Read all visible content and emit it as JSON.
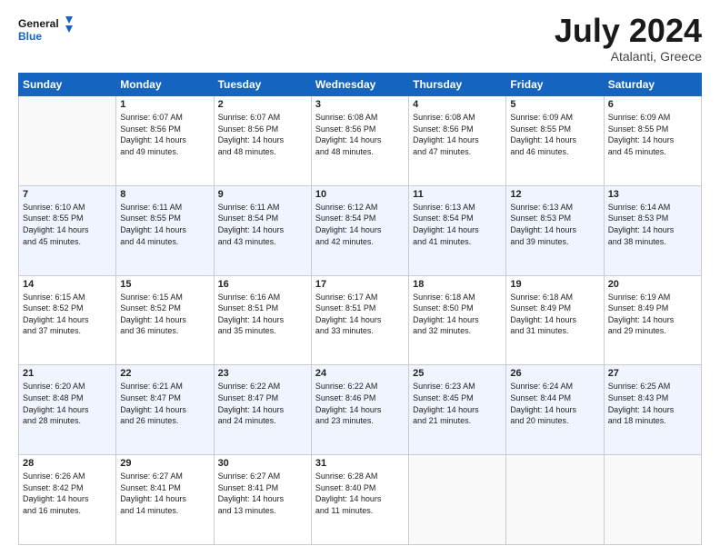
{
  "logo": {
    "line1": "General",
    "line2": "Blue"
  },
  "title": "July 2024",
  "subtitle": "Atalanti, Greece",
  "days_header": [
    "Sunday",
    "Monday",
    "Tuesday",
    "Wednesday",
    "Thursday",
    "Friday",
    "Saturday"
  ],
  "weeks": [
    [
      {
        "day": "",
        "info": ""
      },
      {
        "day": "1",
        "info": "Sunrise: 6:07 AM\nSunset: 8:56 PM\nDaylight: 14 hours\nand 49 minutes."
      },
      {
        "day": "2",
        "info": "Sunrise: 6:07 AM\nSunset: 8:56 PM\nDaylight: 14 hours\nand 48 minutes."
      },
      {
        "day": "3",
        "info": "Sunrise: 6:08 AM\nSunset: 8:56 PM\nDaylight: 14 hours\nand 48 minutes."
      },
      {
        "day": "4",
        "info": "Sunrise: 6:08 AM\nSunset: 8:56 PM\nDaylight: 14 hours\nand 47 minutes."
      },
      {
        "day": "5",
        "info": "Sunrise: 6:09 AM\nSunset: 8:55 PM\nDaylight: 14 hours\nand 46 minutes."
      },
      {
        "day": "6",
        "info": "Sunrise: 6:09 AM\nSunset: 8:55 PM\nDaylight: 14 hours\nand 45 minutes."
      }
    ],
    [
      {
        "day": "7",
        "info": "Sunrise: 6:10 AM\nSunset: 8:55 PM\nDaylight: 14 hours\nand 45 minutes."
      },
      {
        "day": "8",
        "info": "Sunrise: 6:11 AM\nSunset: 8:55 PM\nDaylight: 14 hours\nand 44 minutes."
      },
      {
        "day": "9",
        "info": "Sunrise: 6:11 AM\nSunset: 8:54 PM\nDaylight: 14 hours\nand 43 minutes."
      },
      {
        "day": "10",
        "info": "Sunrise: 6:12 AM\nSunset: 8:54 PM\nDaylight: 14 hours\nand 42 minutes."
      },
      {
        "day": "11",
        "info": "Sunrise: 6:13 AM\nSunset: 8:54 PM\nDaylight: 14 hours\nand 41 minutes."
      },
      {
        "day": "12",
        "info": "Sunrise: 6:13 AM\nSunset: 8:53 PM\nDaylight: 14 hours\nand 39 minutes."
      },
      {
        "day": "13",
        "info": "Sunrise: 6:14 AM\nSunset: 8:53 PM\nDaylight: 14 hours\nand 38 minutes."
      }
    ],
    [
      {
        "day": "14",
        "info": "Sunrise: 6:15 AM\nSunset: 8:52 PM\nDaylight: 14 hours\nand 37 minutes."
      },
      {
        "day": "15",
        "info": "Sunrise: 6:15 AM\nSunset: 8:52 PM\nDaylight: 14 hours\nand 36 minutes."
      },
      {
        "day": "16",
        "info": "Sunrise: 6:16 AM\nSunset: 8:51 PM\nDaylight: 14 hours\nand 35 minutes."
      },
      {
        "day": "17",
        "info": "Sunrise: 6:17 AM\nSunset: 8:51 PM\nDaylight: 14 hours\nand 33 minutes."
      },
      {
        "day": "18",
        "info": "Sunrise: 6:18 AM\nSunset: 8:50 PM\nDaylight: 14 hours\nand 32 minutes."
      },
      {
        "day": "19",
        "info": "Sunrise: 6:18 AM\nSunset: 8:49 PM\nDaylight: 14 hours\nand 31 minutes."
      },
      {
        "day": "20",
        "info": "Sunrise: 6:19 AM\nSunset: 8:49 PM\nDaylight: 14 hours\nand 29 minutes."
      }
    ],
    [
      {
        "day": "21",
        "info": "Sunrise: 6:20 AM\nSunset: 8:48 PM\nDaylight: 14 hours\nand 28 minutes."
      },
      {
        "day": "22",
        "info": "Sunrise: 6:21 AM\nSunset: 8:47 PM\nDaylight: 14 hours\nand 26 minutes."
      },
      {
        "day": "23",
        "info": "Sunrise: 6:22 AM\nSunset: 8:47 PM\nDaylight: 14 hours\nand 24 minutes."
      },
      {
        "day": "24",
        "info": "Sunrise: 6:22 AM\nSunset: 8:46 PM\nDaylight: 14 hours\nand 23 minutes."
      },
      {
        "day": "25",
        "info": "Sunrise: 6:23 AM\nSunset: 8:45 PM\nDaylight: 14 hours\nand 21 minutes."
      },
      {
        "day": "26",
        "info": "Sunrise: 6:24 AM\nSunset: 8:44 PM\nDaylight: 14 hours\nand 20 minutes."
      },
      {
        "day": "27",
        "info": "Sunrise: 6:25 AM\nSunset: 8:43 PM\nDaylight: 14 hours\nand 18 minutes."
      }
    ],
    [
      {
        "day": "28",
        "info": "Sunrise: 6:26 AM\nSunset: 8:42 PM\nDaylight: 14 hours\nand 16 minutes."
      },
      {
        "day": "29",
        "info": "Sunrise: 6:27 AM\nSunset: 8:41 PM\nDaylight: 14 hours\nand 14 minutes."
      },
      {
        "day": "30",
        "info": "Sunrise: 6:27 AM\nSunset: 8:41 PM\nDaylight: 14 hours\nand 13 minutes."
      },
      {
        "day": "31",
        "info": "Sunrise: 6:28 AM\nSunset: 8:40 PM\nDaylight: 14 hours\nand 11 minutes."
      },
      {
        "day": "",
        "info": ""
      },
      {
        "day": "",
        "info": ""
      },
      {
        "day": "",
        "info": ""
      }
    ]
  ]
}
